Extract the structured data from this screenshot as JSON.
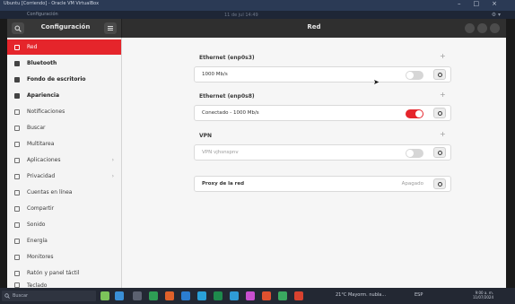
{
  "host": {
    "window_title": "Ubuntu [Corriendo] - Oracle VM VirtualBox",
    "tab_label": "Configuración",
    "top_bar_text": "11 de jul  14:49"
  },
  "headerbar": {
    "left_title": "Configuración",
    "main_title": "Red"
  },
  "sidebar": {
    "items": [
      {
        "label": "Red",
        "icon": "network-icon",
        "active": true
      },
      {
        "label": "Bluetooth",
        "icon": "bluetooth-icon"
      },
      {
        "label": "Fondo de escritorio",
        "icon": "wallpaper-icon"
      },
      {
        "label": "Apariencia",
        "icon": "appearance-icon"
      },
      {
        "label": "Notificaciones",
        "icon": "bell-icon"
      },
      {
        "label": "Buscar",
        "icon": "search-icon"
      },
      {
        "label": "Multitarea",
        "icon": "multitask-icon"
      },
      {
        "label": "Aplicaciones",
        "icon": "apps-icon",
        "chevron": "›"
      },
      {
        "label": "Privacidad",
        "icon": "lock-icon",
        "chevron": "›"
      },
      {
        "label": "Cuentas en línea",
        "icon": "cloud-icon"
      },
      {
        "label": "Compartir",
        "icon": "share-icon"
      },
      {
        "label": "Sonido",
        "icon": "music-icon"
      },
      {
        "label": "Energía",
        "icon": "power-icon"
      },
      {
        "label": "Monitores",
        "icon": "monitor-icon"
      },
      {
        "label": "Ratón y panel táctil",
        "icon": "mouse-icon"
      },
      {
        "label": "Teclado",
        "icon": "keyboard-icon"
      }
    ]
  },
  "main": {
    "sections": [
      {
        "title": "Ethernet (enp0s3)",
        "add": "+",
        "row_label": "1000 Mb/s",
        "toggle_on": false
      },
      {
        "title": "Ethernet (enp0s8)",
        "add": "+",
        "row_label": "Conectado - 1000 Mb/s",
        "toggle_on": true
      },
      {
        "title": "VPN",
        "add": "+",
        "row_label": "VPN vjhsnspnv",
        "toggle_on": false
      }
    ],
    "proxy": {
      "label": "Proxy de la red",
      "value": "Apagado"
    }
  },
  "taskbar": {
    "search_text": "Buscar",
    "weather": "21°C  Mayorm. nubla...",
    "sys_text": "ESP",
    "time": "9:00 a. m.",
    "date": "11/07/2024"
  },
  "colors": {
    "accent": "#e5252b",
    "headerbar": "#2f2f2f",
    "taskbar": "#232833"
  }
}
